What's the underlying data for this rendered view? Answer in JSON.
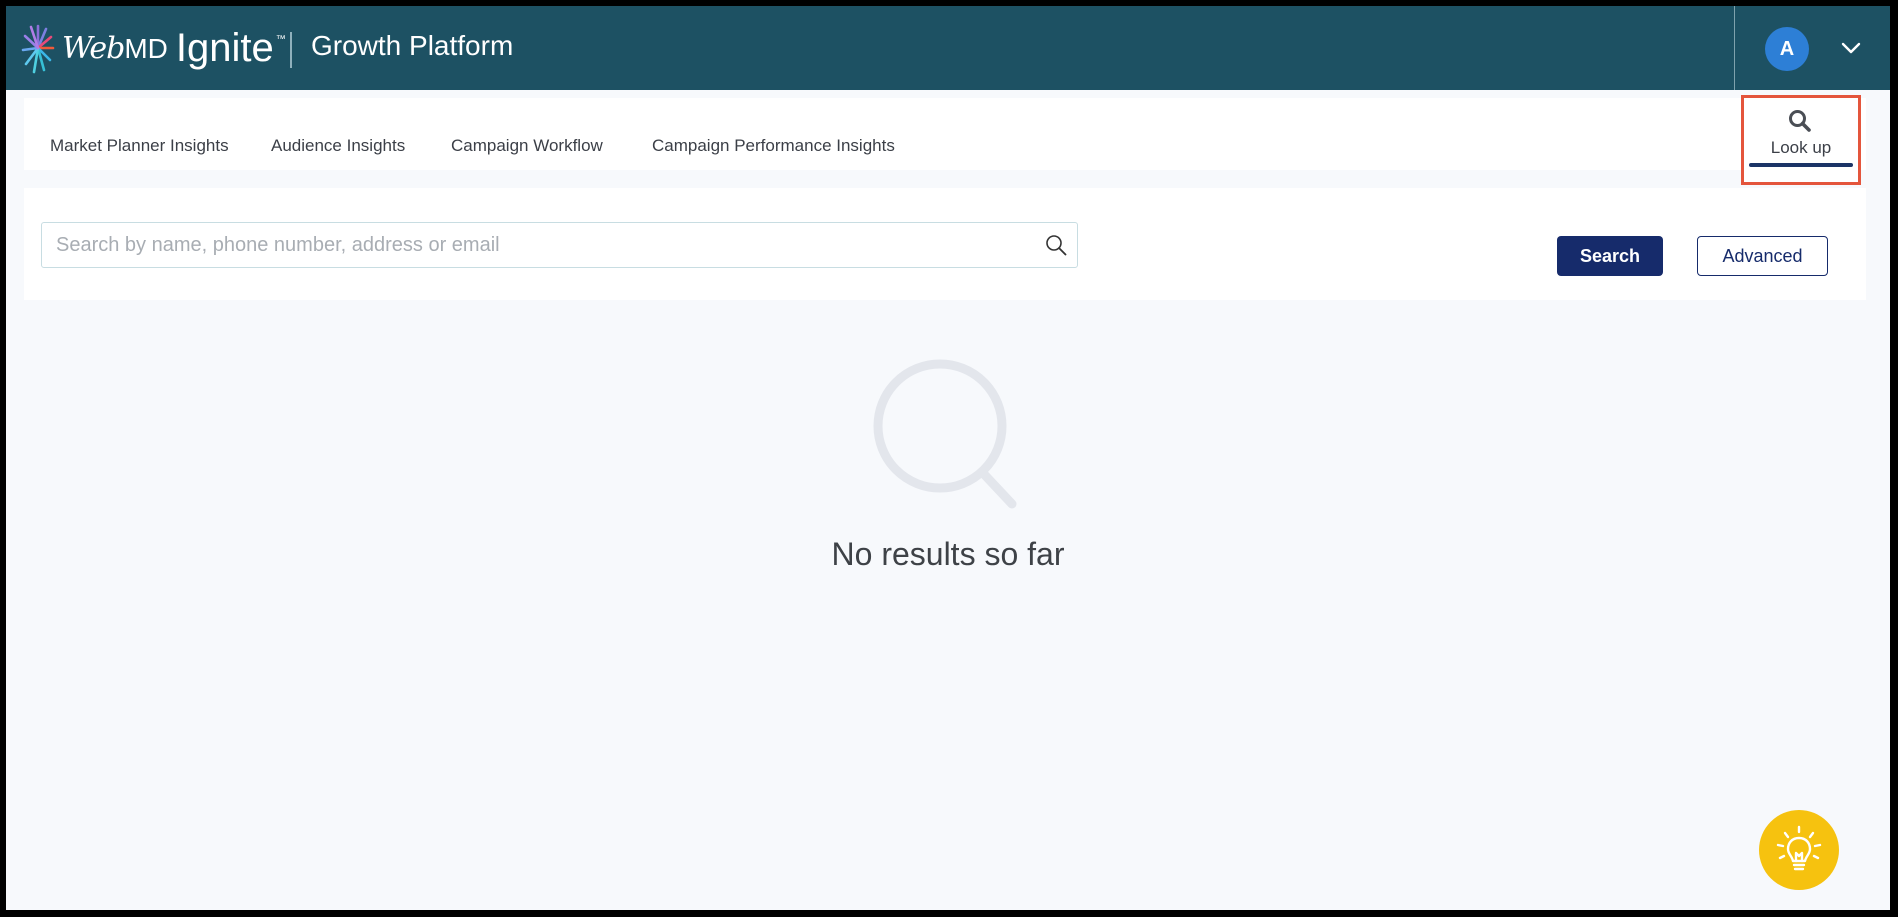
{
  "header": {
    "logo_webmd_italic": "Web",
    "logo_webmd_md": "MD",
    "logo_ignite": "Ignite",
    "logo_tm": "™",
    "platform_title": "Growth Platform",
    "avatar_initial": "A",
    "icons": {
      "logo": "burst-logo-icon",
      "account_menu": "chevron-down-icon"
    }
  },
  "nav": {
    "items": [
      {
        "label": "Market Planner Insights"
      },
      {
        "label": "Audience Insights"
      },
      {
        "label": "Campaign Workflow"
      },
      {
        "label": "Campaign Performance Insights"
      }
    ],
    "lookup": {
      "label": "Look up",
      "icon": "search-icon",
      "active": true
    }
  },
  "search": {
    "placeholder": "Search by name, phone number, address or email",
    "value": "",
    "icon": "search-icon",
    "search_button": "Search",
    "advanced_button": "Advanced"
  },
  "empty_state": {
    "icon": "magnifier-icon",
    "message": "No results so far"
  },
  "help": {
    "icon": "lightbulb-icon"
  },
  "colors": {
    "header_bg": "#1d5163",
    "primary": "#162b6b",
    "avatar": "#2d7fd6",
    "highlight": "#e4553c",
    "help": "#f6c20f"
  }
}
